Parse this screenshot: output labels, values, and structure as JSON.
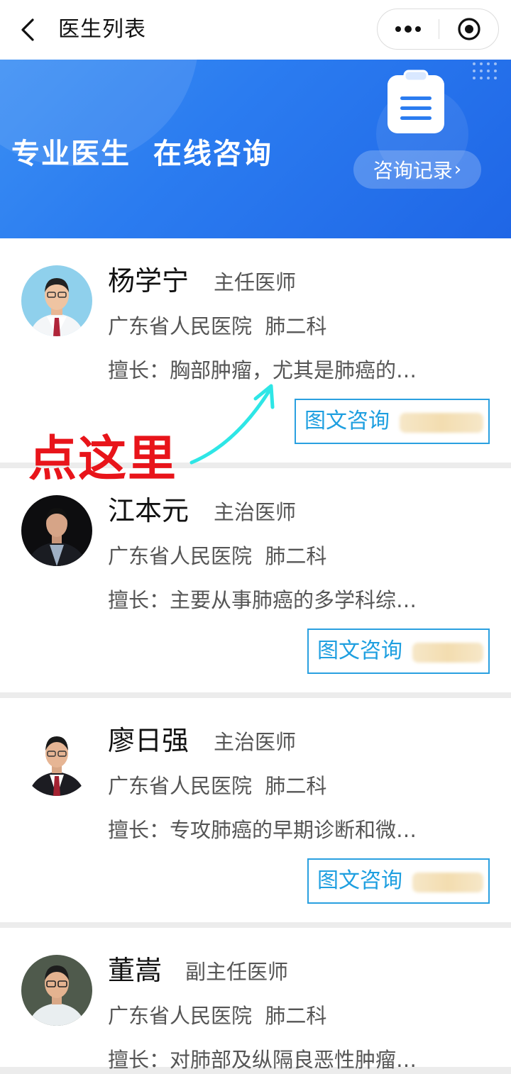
{
  "nav": {
    "title": "医生列表",
    "icons": {
      "back": "chevron-left-icon",
      "more": "more-dots-icon",
      "close": "target-close-icon"
    }
  },
  "banner": {
    "title": "专业医生  在线咨询",
    "records_button": "咨询记录",
    "records_chevron": "›",
    "icon": "clipboard-icon",
    "colors": {
      "from": "#3a8ef3",
      "to": "#1f66e6"
    }
  },
  "doctors": [
    {
      "name": "杨学宁",
      "title": "主任医师",
      "hospital": "广东省人民医院  肺二科",
      "specialty": "擅长：胸部肿瘤，尤其是肺癌的…",
      "consult_label": "图文咨询"
    },
    {
      "name": "江本元",
      "title": "主治医师",
      "hospital": "广东省人民医院  肺二科",
      "specialty": "擅长：主要从事肺癌的多学科综…",
      "consult_label": "图文咨询"
    },
    {
      "name": "廖日强",
      "title": "主治医师",
      "hospital": "广东省人民医院  肺二科",
      "specialty": "擅长：专攻肺癌的早期诊断和微…",
      "consult_label": "图文咨询"
    },
    {
      "name": "董嵩",
      "title": "副主任医师",
      "hospital": "广东省人民医院  肺二科",
      "specialty": "擅长：对肺部及纵隔良恶性肿瘤…",
      "consult_label": "图文咨询"
    }
  ],
  "annotation": {
    "text": "点这里",
    "color": "#e8141a",
    "arrow_color": "#2ee6e6"
  },
  "colors": {
    "accent": "#1e9fe0",
    "page_bg": "#ececec"
  }
}
